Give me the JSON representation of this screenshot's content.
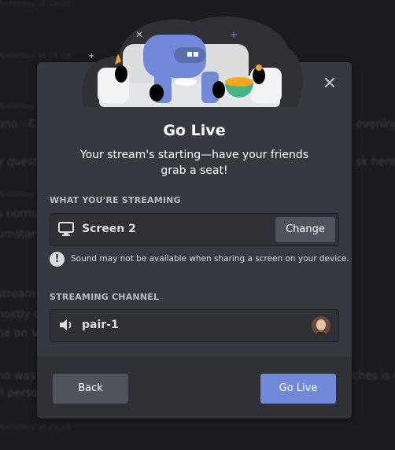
{
  "background": {
    "lines": [
      {
        "text": "Yesterday at 19:00",
        "ts": true
      },
      {
        "text": "Yesterday at 19:08",
        "ts": true
      },
      {
        "text": "Yesterday at 19:10",
        "ts": true
      },
      {
        "text": "uno - C",
        "right": "evening"
      },
      {
        "text": "y quest",
        "right": "sk here."
      },
      {
        "text": "Yesterday at",
        "ts": true
      },
      {
        "text": "s norma"
      },
      {
        "text": "umstan"
      },
      {
        "text": "stream"
      },
      {
        "text": "nostly c"
      },
      {
        "text": "ne on V"
      },
      {
        "text": "no was",
        "right": "ches is c"
      },
      {
        "text": "n perso"
      },
      {
        "text": "Yesterday at 21:10",
        "ts": true
      }
    ]
  },
  "modal": {
    "title": "Go Live",
    "subtitle": "Your stream's starting—have your friends grab a seat!",
    "what_label": "WHAT YOU'RE STREAMING",
    "source_name": "Screen 2",
    "change_label": "Change",
    "warning": "Sound may not be available when sharing a screen on your device.",
    "channel_label": "STREAMING CHANNEL",
    "channel_name": "pair-1",
    "back_label": "Back",
    "go_label": "Go Live",
    "close_glyph": "✕"
  },
  "colors": {
    "accent": "#7289da",
    "modal_bg": "#36393f",
    "footer_bg": "#2f3136"
  },
  "icons": [
    "close-icon",
    "monitor-icon",
    "alert-icon",
    "speaker-icon",
    "avatar"
  ]
}
